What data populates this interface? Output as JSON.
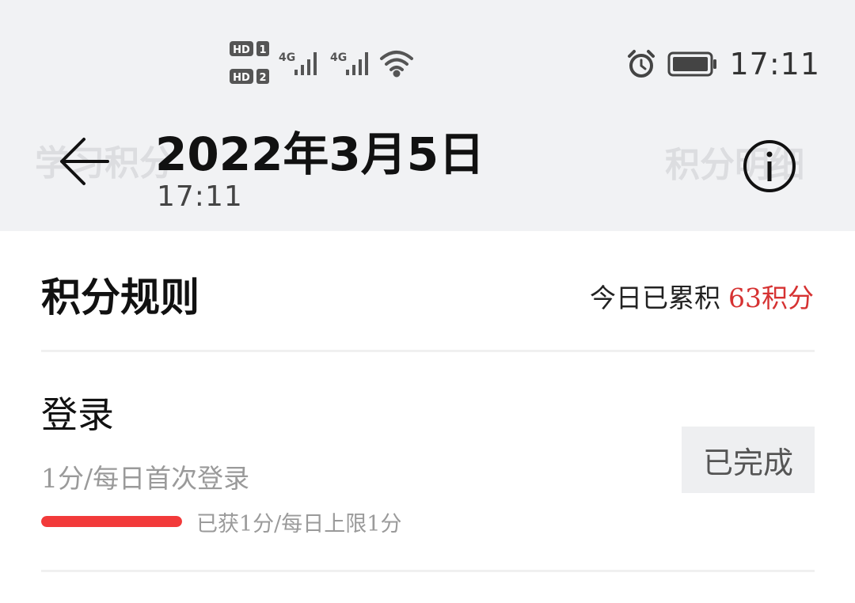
{
  "status_bar": {
    "time": "17:11",
    "icons": [
      "hd-1-icon",
      "hd-2-icon",
      "signal-4g-icon",
      "signal-4g-icon",
      "wifi-icon",
      "alarm-icon",
      "battery-icon"
    ],
    "hd_labels": [
      "HD",
      "1",
      "HD",
      "2"
    ],
    "network_labels": [
      "4G",
      "4G"
    ]
  },
  "header": {
    "date": "2022年3月5日",
    "time": "17:11",
    "ghost_left": "学习积分",
    "ghost_right": "积分明细",
    "back_icon": "back-arrow-icon",
    "info_icon": "info-icon"
  },
  "rules": {
    "title": "积分规则",
    "today_label": "今日已累积",
    "today_points": "63积分"
  },
  "items": [
    {
      "title": "登录",
      "description": "1分/每日首次登录",
      "progress_text": "已获1分/每日上限1分",
      "progress": 1.0,
      "button_label": "已完成"
    }
  ],
  "colors": {
    "accent_red": "#d63232",
    "progress_red": "#f23a3a",
    "header_bg": "#f1f2f4"
  }
}
